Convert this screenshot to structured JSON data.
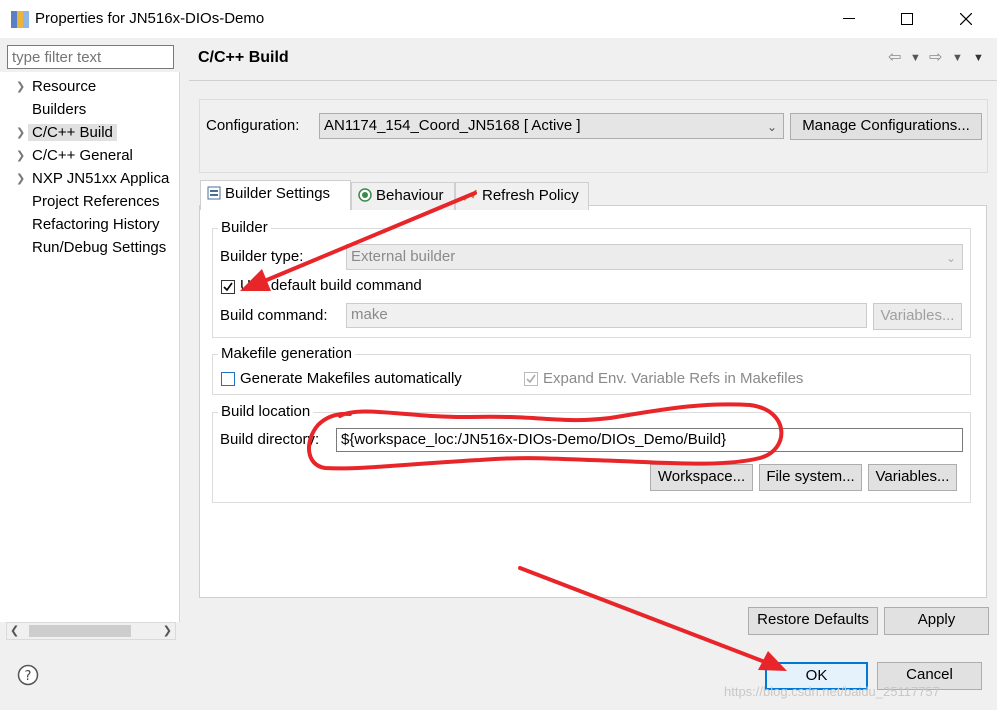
{
  "window": {
    "title": "Properties for JN516x-DIOs-Demo"
  },
  "nav": {
    "filter_placeholder": "type filter text",
    "items": [
      {
        "label": "Resource",
        "expandable": true
      },
      {
        "label": "Builders",
        "expandable": false
      },
      {
        "label": "C/C++ Build",
        "expandable": true,
        "selected": true
      },
      {
        "label": "C/C++ General",
        "expandable": true
      },
      {
        "label": "NXP JN51xx Applica",
        "expandable": true
      },
      {
        "label": "Project References",
        "expandable": false
      },
      {
        "label": "Refactoring History",
        "expandable": false
      },
      {
        "label": "Run/Debug Settings",
        "expandable": false
      }
    ]
  },
  "page": {
    "title": "C/C++ Build"
  },
  "configuration": {
    "label": "Configuration:",
    "value": "AN1174_154_Coord_JN5168  [ Active ]",
    "manage_button": "Manage Configurations..."
  },
  "tabs": [
    {
      "label": "Builder Settings",
      "active": true,
      "icon": "builder-settings-icon"
    },
    {
      "label": "Behaviour",
      "active": false,
      "icon": "behaviour-icon"
    },
    {
      "label": "Refresh Policy",
      "active": false,
      "icon": "refresh-policy-icon"
    }
  ],
  "builder": {
    "group_title": "Builder",
    "type_label": "Builder type:",
    "type_value": "External builder",
    "use_default_label": "Use default build command",
    "use_default_checked": true,
    "command_label": "Build command:",
    "command_value": "make",
    "variables_button": "Variables..."
  },
  "makefile": {
    "group_title": "Makefile generation",
    "generate_label": "Generate Makefiles automatically",
    "generate_checked": false,
    "expand_label": "Expand Env. Variable Refs in Makefiles",
    "expand_checked": true
  },
  "location": {
    "group_title": "Build location",
    "directory_label": "Build directory:",
    "directory_value": "${workspace_loc:/JN516x-DIOs-Demo/DIOs_Demo/Build}",
    "workspace_button": "Workspace...",
    "filesystem_button": "File system...",
    "variables_button": "Variables..."
  },
  "actions": {
    "restore_defaults": "Restore Defaults",
    "apply": "Apply",
    "ok": "OK",
    "cancel": "Cancel"
  },
  "watermark": "https://blog.csdn.net/baidu_25117757",
  "colors": {
    "annotation_red": "#e8262a",
    "accent_blue": "#0078d7"
  }
}
